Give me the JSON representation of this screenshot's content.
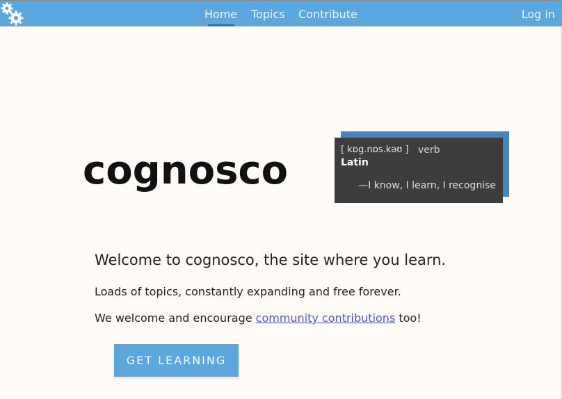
{
  "nav": {
    "items": [
      {
        "label": "Home",
        "active": true
      },
      {
        "label": "Topics"
      },
      {
        "label": "Contribute"
      }
    ],
    "login_label": "Log in",
    "logo_icon": "gears-icon"
  },
  "hero": {
    "brand": "cognosco",
    "definition": {
      "pronunciation": "[ kɒg.nɒs.kəʊ ]",
      "part_of_speech": "verb",
      "language": "Latin",
      "meaning": "—I know, I learn, I recognise"
    }
  },
  "intro": {
    "welcome": "Welcome to cognosco, the site where you learn.",
    "line1": "Loads of topics, constantly expanding and free forever.",
    "line2_before": "We welcome and encourage ",
    "line2_link": "community contributions",
    "line2_after": " too!",
    "cta": "GET LEARNING"
  },
  "colors": {
    "topbar": "#5aa6de",
    "accent_dark": "#2d72b0",
    "card_bg": "#3d3d3d",
    "card_shadow": "#3f86c6",
    "link": "#4b55d4"
  }
}
